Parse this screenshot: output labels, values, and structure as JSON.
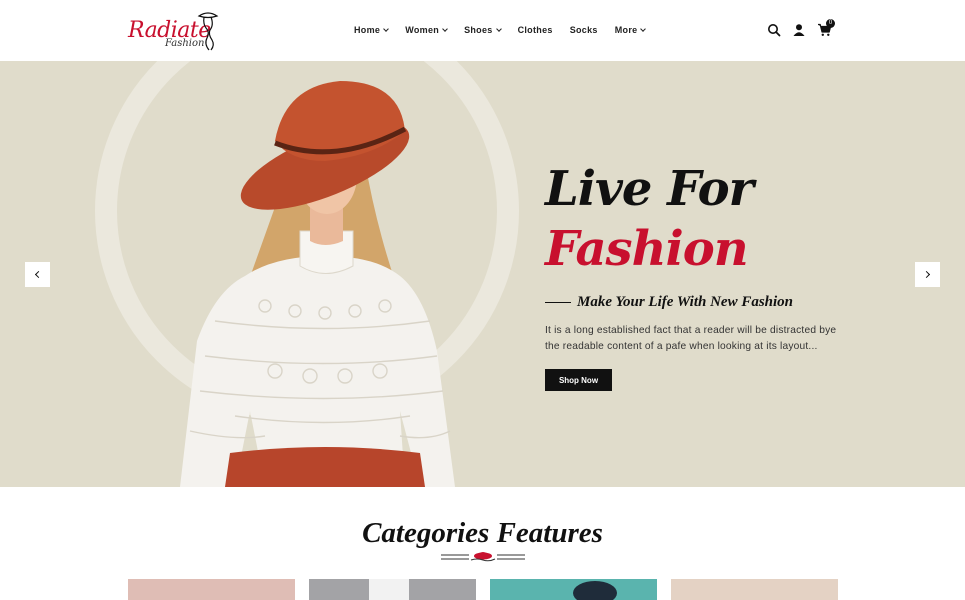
{
  "brand": {
    "name": "Radiate",
    "sub": "Fashion",
    "accent": "#c8102e"
  },
  "nav": [
    {
      "label": "Home",
      "has_dropdown": true
    },
    {
      "label": "Women",
      "has_dropdown": true
    },
    {
      "label": "Shoes",
      "has_dropdown": true
    },
    {
      "label": "Clothes",
      "has_dropdown": false
    },
    {
      "label": "Socks",
      "has_dropdown": false
    },
    {
      "label": "More",
      "has_dropdown": true
    }
  ],
  "header_icons": [
    "search-icon",
    "user-icon",
    "cart-icon"
  ],
  "cart": {
    "count": "0"
  },
  "hero": {
    "headline_line1": "Live For",
    "headline_line2": "Fashion",
    "tagline": "Make Your Life With New Fashion",
    "description": "It is a long established fact that a reader will be distracted bye the readable content of a pafe when looking at its layout...",
    "cta_label": "Shop Now",
    "background": "#e0dccb"
  },
  "categories": {
    "title": "Categories Features"
  }
}
